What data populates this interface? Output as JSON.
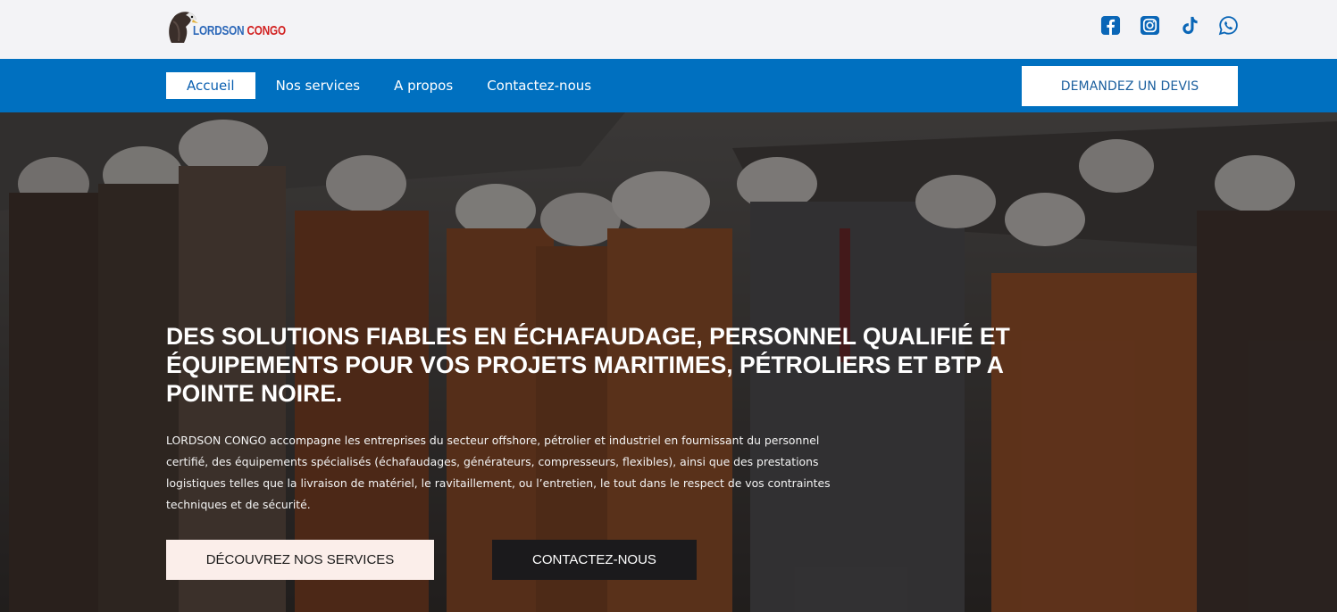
{
  "brand": {
    "name_part1": "LORDSON",
    "name_part2": "CONGO",
    "colors": {
      "blue": "#2b67b8",
      "red": "#d11f1f"
    }
  },
  "socials": [
    {
      "name": "facebook-icon"
    },
    {
      "name": "instagram-icon"
    },
    {
      "name": "tiktok-icon"
    },
    {
      "name": "whatsapp-icon"
    }
  ],
  "nav": {
    "items": [
      {
        "label": "Accueil",
        "active": true
      },
      {
        "label": "Nos services",
        "active": false
      },
      {
        "label": "A propos",
        "active": false
      },
      {
        "label": "Contactez-nous",
        "active": false
      }
    ],
    "cta_label": "DEMANDEZ UN DEVIS",
    "bar_color": "#0070c0"
  },
  "hero": {
    "title": "DES SOLUTIONS FIABLES EN ÉCHAFAUDAGE, PERSONNEL QUALIFIÉ ET ÉQUIPEMENTS POUR VOS PROJETS MARITIMES, PÉTROLIERS ET BTP A POINTE NOIRE.",
    "description": "LORDSON CONGO accompagne les entreprises du secteur offshore, pétrolier et industriel en fournissant du personnel certifié, des équipements spécialisés (échafaudages, générateurs, compresseurs, flexibles), ainsi que des prestations logistiques telles que la livraison de matériel, le ravitaillement, ou l’entretien, le tout dans le respect de vos contraintes techniques et de sécurité.",
    "primary_button": "DÉCOUVREZ NOS SERVICES",
    "secondary_button": "CONTACTEZ-NOUS"
  }
}
